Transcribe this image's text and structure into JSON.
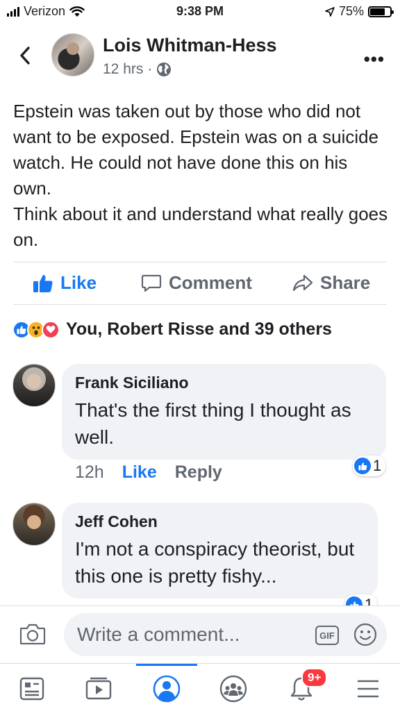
{
  "status_bar": {
    "carrier": "Verizon",
    "time": "9:38 PM",
    "battery_percent": "75%",
    "battery_level": 0.75
  },
  "post": {
    "author": "Lois Whitman-Hess",
    "time": "12 hrs",
    "body": "Epstein was taken out by those who did not want to be exposed. Epstein was on a suicide watch. He could not have done this on his own.\nThink about it and understand what really goes on."
  },
  "actions": {
    "like": "Like",
    "comment": "Comment",
    "share": "Share"
  },
  "reactions": {
    "icons": [
      "like-icon",
      "wow-icon",
      "love-icon"
    ],
    "summary": "You, Robert Risse and 39 others"
  },
  "comments": [
    {
      "name": "Frank Siciliano",
      "text": "That's the first thing I thought as well.",
      "time": "12h",
      "like_label": "Like",
      "reply_label": "Reply",
      "reaction_count": "1"
    },
    {
      "name": "Jeff Cohen",
      "text": "I'm not a conspiracy theorist, but this one is pretty fishy...",
      "reaction_count": "1"
    }
  ],
  "composer": {
    "placeholder": "Write a comment...",
    "gif_label": "GIF"
  },
  "bottom_nav": {
    "items": [
      "news-feed-icon",
      "watch-icon",
      "profile-icon",
      "groups-icon",
      "notifications-icon",
      "menu-icon"
    ],
    "active": "profile-icon",
    "notification_badge": "9+"
  },
  "colors": {
    "accent": "#1877f2",
    "badge": "#fa383e",
    "bubble": "#f0f2f5",
    "secondary_text": "#606770"
  }
}
